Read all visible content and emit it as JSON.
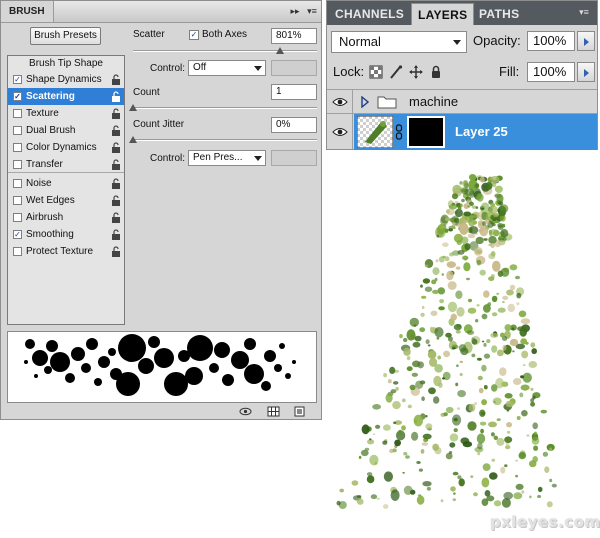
{
  "brush_panel": {
    "tab_label": "BRUSH",
    "presets_button": "Brush Presets",
    "tip_heading": "Brush Tip Shape",
    "items": [
      {
        "label": "Shape Dynamics",
        "checked": true,
        "selected": false,
        "lock": true
      },
      {
        "label": "Scattering",
        "checked": true,
        "selected": true,
        "lock": true
      },
      {
        "label": "Texture",
        "checked": false,
        "selected": false,
        "lock": true
      },
      {
        "label": "Dual Brush",
        "checked": false,
        "selected": false,
        "lock": true
      },
      {
        "label": "Color Dynamics",
        "checked": false,
        "selected": false,
        "lock": true
      },
      {
        "label": "Transfer",
        "checked": false,
        "selected": false,
        "lock": true
      },
      {
        "label": "Noise",
        "checked": false,
        "selected": false,
        "lock": true
      },
      {
        "label": "Wet Edges",
        "checked": false,
        "selected": false,
        "lock": true
      },
      {
        "label": "Airbrush",
        "checked": false,
        "selected": false,
        "lock": true
      },
      {
        "label": "Smoothing",
        "checked": true,
        "selected": false,
        "lock": true
      },
      {
        "label": "Protect Texture",
        "checked": false,
        "selected": false,
        "lock": true
      }
    ],
    "scatter": {
      "label": "Scatter",
      "both_axes_label": "Both Axes",
      "both_axes_checked": true,
      "value": "801%",
      "slider_fraction": 0.8,
      "control_label": "Control:",
      "control_value": "Off"
    },
    "count": {
      "label": "Count",
      "value": "1",
      "slider_fraction": 0.0
    },
    "count_jitter": {
      "label": "Count Jitter",
      "value": "0%",
      "slider_fraction": 0.0,
      "control_label": "Control:",
      "control_value": "Pen Pres..."
    }
  },
  "layers_panel": {
    "tabs": [
      {
        "label": "CHANNELS",
        "active": false
      },
      {
        "label": "LAYERS",
        "active": true
      },
      {
        "label": "PATHS",
        "active": false
      }
    ],
    "blend_mode": "Normal",
    "opacity_label": "Opacity:",
    "opacity_value": "100%",
    "lock_label": "Lock:",
    "fill_label": "Fill:",
    "fill_value": "100%",
    "layers": [
      {
        "name": "machine",
        "type": "group",
        "visible": true,
        "selected": false
      },
      {
        "name": "Layer 25",
        "type": "layer",
        "visible": true,
        "selected": true
      }
    ]
  },
  "watermark": "pxleyes.com",
  "colors": {
    "selection_blue": "#2f7fd6",
    "layer_selected": "#3a8fdc",
    "panel_gray": "#d6d6d6",
    "tab_bar": "#555a60"
  }
}
